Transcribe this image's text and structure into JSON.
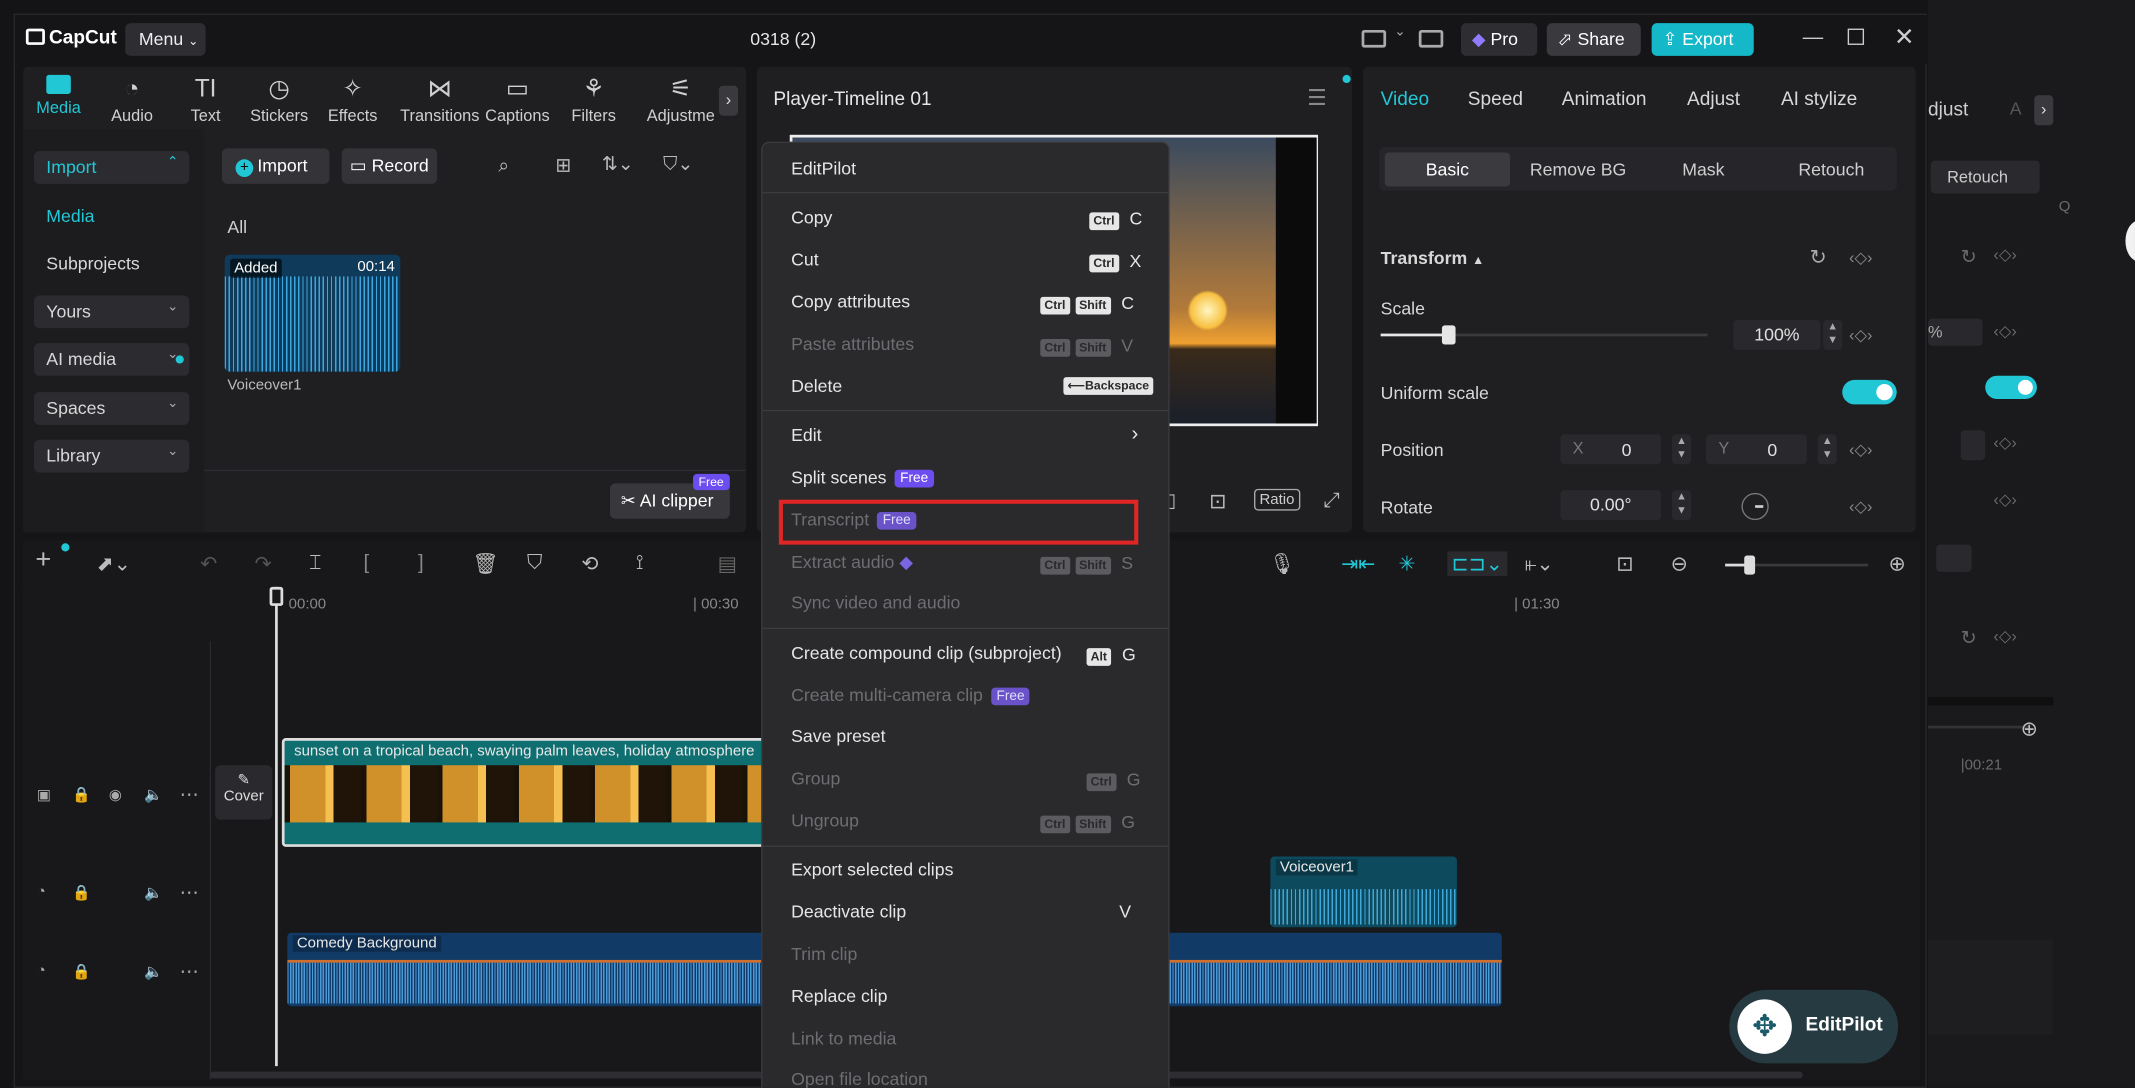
{
  "app": {
    "logo": "CapCut",
    "menu_label": "Menu",
    "project_title": "0318 (2)",
    "pro_label": "Pro",
    "share_label": "Share",
    "export_label": "Export"
  },
  "media_tabs": [
    "Media",
    "Audio",
    "Text",
    "Stickers",
    "Effects",
    "Transitions",
    "Captions",
    "Filters",
    "Adjustme"
  ],
  "sidebar": {
    "import": "Import",
    "media": "Media",
    "subprojects": "Subprojects",
    "yours": "Yours",
    "ai_media": "AI media",
    "spaces": "Spaces",
    "library": "Library"
  },
  "media_panel": {
    "import_btn": "Import",
    "record_btn": "Record",
    "filter_label": "All",
    "asset": {
      "badge": "Added",
      "duration": "00:14",
      "name": "Voiceover1"
    },
    "ai_clipper": "AI clipper",
    "free": "Free"
  },
  "player": {
    "title": "Player-Timeline 01",
    "ratio": "Ratio"
  },
  "props": {
    "tabs": [
      "Video",
      "Speed",
      "Animation",
      "Adjust",
      "AI stylize"
    ],
    "subtabs": [
      "Basic",
      "Remove BG",
      "Mask",
      "Retouch"
    ],
    "transform": "Transform",
    "scale_label": "Scale",
    "scale_value": "100%",
    "uniform": "Uniform scale",
    "position": "Position",
    "x_label": "X",
    "x_value": "0",
    "y_label": "Y",
    "y_value": "0",
    "rotate": "Rotate",
    "rotate_value": "0.00°"
  },
  "bg_window": {
    "adjust": "djust",
    "a": "A",
    "retouch": "Retouch",
    "q": "Q",
    "percent": "%",
    "time": "|00:21"
  },
  "timeline": {
    "ruler": [
      "00:00",
      "| 00:30",
      "| 01:30"
    ],
    "cover": "Cover",
    "video_clip": "sunset on a tropical beach, swaying palm leaves, holiday atmosphere",
    "voice_clip": "Voiceover1",
    "music_clip": "Comedy Background"
  },
  "context_menu": {
    "items": [
      {
        "label": "EditPilot",
        "enabled": true
      },
      {
        "label": "Copy",
        "enabled": true,
        "keys": [
          "Ctrl"
        ],
        "char": "C"
      },
      {
        "label": "Cut",
        "enabled": true,
        "keys": [
          "Ctrl"
        ],
        "char": "X"
      },
      {
        "label": "Copy attributes",
        "enabled": true,
        "keys": [
          "Ctrl",
          "Shift"
        ],
        "char": "C"
      },
      {
        "label": "Paste attributes",
        "enabled": false,
        "keys": [
          "Ctrl",
          "Shift"
        ],
        "char": "V"
      },
      {
        "label": "Delete",
        "enabled": true,
        "keys": [
          "⟵Backspace"
        ],
        "char": ""
      },
      {
        "label": "Edit",
        "enabled": true
      },
      {
        "label": "Split scenes",
        "enabled": true,
        "badge": "Free"
      },
      {
        "label": "Transcript",
        "enabled": false,
        "badge": "Free"
      },
      {
        "label": "Extract audio",
        "enabled": false,
        "keys": [
          "Ctrl",
          "Shift"
        ],
        "char": "S"
      },
      {
        "label": "Sync video and audio",
        "enabled": false
      },
      {
        "label": "Create compound clip (subproject)",
        "enabled": true,
        "keys": [
          "Alt"
        ],
        "char": "G"
      },
      {
        "label": "Create multi-camera clip",
        "enabled": false,
        "badge": "Free"
      },
      {
        "label": "Save preset",
        "enabled": true
      },
      {
        "label": "Group",
        "enabled": false,
        "keys": [
          "Ctrl"
        ],
        "char": "G"
      },
      {
        "label": "Ungroup",
        "enabled": false,
        "keys": [
          "Ctrl",
          "Shift"
        ],
        "char": "G"
      },
      {
        "label": "Export selected clips",
        "enabled": true
      },
      {
        "label": "Deactivate clip",
        "enabled": true,
        "char": "V"
      },
      {
        "label": "Trim clip",
        "enabled": false
      },
      {
        "label": "Replace clip",
        "enabled": true
      },
      {
        "label": "Link to media",
        "enabled": false
      },
      {
        "label": "Open file location",
        "enabled": false
      }
    ]
  },
  "editpilot_btn": "EditPilot",
  "colors": {
    "accent": "#22c7d6",
    "highlight": "#e02525",
    "free_badge": "#6c4df0"
  }
}
